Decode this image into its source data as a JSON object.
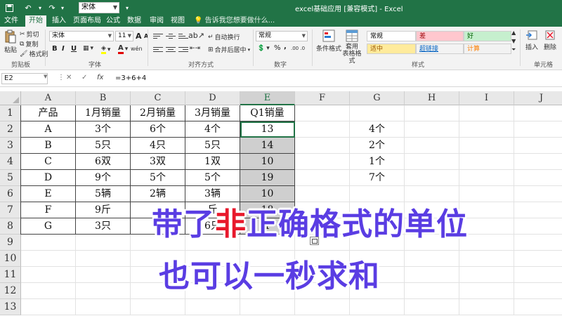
{
  "quick_access": {
    "font": "宋体",
    "title": "excel基础应用 [兼容模式] - Excel"
  },
  "tabs": [
    {
      "label": "文件"
    },
    {
      "label": "开始"
    },
    {
      "label": "插入"
    },
    {
      "label": "页面布局"
    },
    {
      "label": "公式"
    },
    {
      "label": "数据"
    },
    {
      "label": "审阅"
    },
    {
      "label": "视图"
    }
  ],
  "tell_me": "告诉我您想要做什么...",
  "ribbon": {
    "clipboard": {
      "paste": "粘贴",
      "cut": "剪切",
      "copy": "复制",
      "format_painter": "格式刷",
      "label": "剪贴板"
    },
    "font": {
      "name": "宋体",
      "size": "11",
      "label": "字体",
      "bold": "B",
      "italic": "I",
      "underline": "U",
      "grow": "A",
      "shrink": "A",
      "color": "A",
      "phonetic": "wén"
    },
    "alignment": {
      "wrap": "自动换行",
      "merge": "合并后居中",
      "label": "对齐方式"
    },
    "number": {
      "format": "常规",
      "label": "数字",
      "percent": "%",
      "comma": ","
    },
    "styles": {
      "conditional": "条件格式",
      "table": "套用\n表格格式",
      "label": "样式",
      "cells": [
        {
          "label": "常规",
          "bg": "#ffffff",
          "fg": "#000000"
        },
        {
          "label": "差",
          "bg": "#ffc7ce",
          "fg": "#9c0006"
        },
        {
          "label": "好",
          "bg": "#c6efce",
          "fg": "#006100"
        },
        {
          "label": "适中",
          "bg": "#ffeb9c",
          "fg": "#9c5700"
        },
        {
          "label": "超链接",
          "bg": "#f3f3f3",
          "fg": "#0563c1"
        },
        {
          "label": "计算",
          "bg": "#f2f2f2",
          "fg": "#fa7d00"
        }
      ]
    },
    "cells": {
      "insert": "插入",
      "delete": "删除",
      "label": "单元格"
    }
  },
  "formula_bar": {
    "name_box": "E2",
    "cancel": "✕",
    "enter": "✓",
    "fx": "fx",
    "formula": "=3+6+4"
  },
  "columns": [
    "A",
    "B",
    "C",
    "D",
    "E",
    "F",
    "G",
    "H",
    "I",
    "J"
  ],
  "rows": [
    "1",
    "2",
    "3",
    "4",
    "5",
    "6",
    "7",
    "8",
    "9",
    "10",
    "11",
    "12",
    "13"
  ],
  "table": {
    "headers": [
      "产品",
      "1月销量",
      "2月销量",
      "3月销量",
      "Q1销量"
    ],
    "rows": [
      [
        "A",
        "3个",
        "6个",
        "4个",
        "13"
      ],
      [
        "B",
        "5只",
        "4只",
        "5只",
        "14"
      ],
      [
        "C",
        "6双",
        "3双",
        "1双",
        "10"
      ],
      [
        "D",
        "9个",
        "5个",
        "5个",
        "19"
      ],
      [
        "E",
        "5辆",
        "2辆",
        "3辆",
        "10"
      ],
      [
        "F",
        "9斤",
        "",
        "斤",
        "18"
      ],
      [
        "G",
        "3只",
        "",
        "6只",
        "1"
      ]
    ]
  },
  "side_values": [
    "4个",
    "2个",
    "1个",
    "7个"
  ],
  "caption": {
    "line1_a": "带了",
    "line1_hl": "非",
    "line1_b": "正确格式的单位",
    "line2": "也可以一秒求和",
    "color": "#5a3de3",
    "highlight": "#e8192c"
  },
  "colors": {
    "excel_green": "#217346"
  }
}
